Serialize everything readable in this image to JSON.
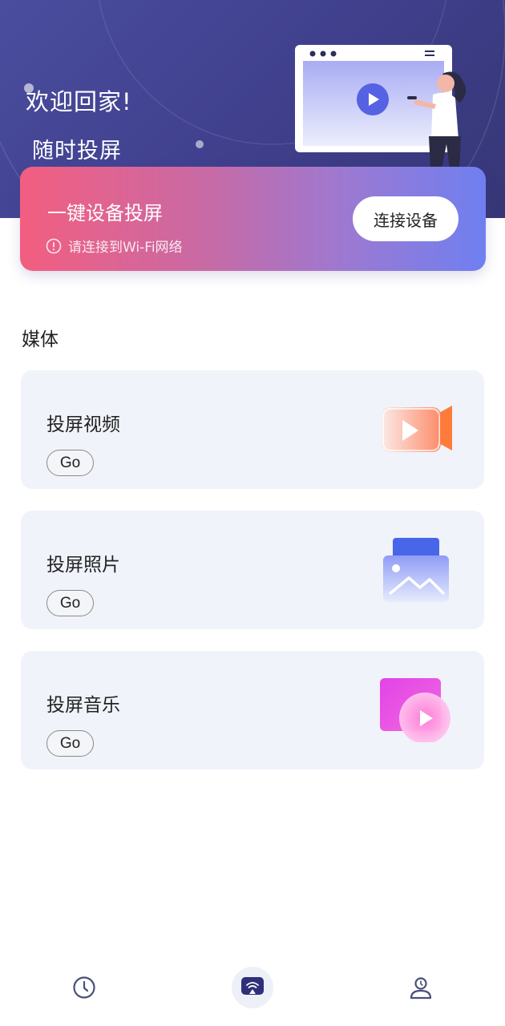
{
  "header": {
    "title": "欢迎回家!",
    "subtitle": "随时投屏"
  },
  "connect": {
    "title": "一键设备投屏",
    "warning": "请连接到Wi-Fi网络",
    "button_label": "连接设备"
  },
  "media": {
    "section_title": "媒体",
    "items": [
      {
        "label": "投屏视频",
        "go_label": "Go",
        "icon": "video-camera-icon"
      },
      {
        "label": "投屏照片",
        "go_label": "Go",
        "icon": "photo-icon"
      },
      {
        "label": "投屏音乐",
        "go_label": "Go",
        "icon": "music-play-icon"
      }
    ]
  },
  "nav": {
    "items": [
      {
        "icon": "clock-icon",
        "active": false
      },
      {
        "icon": "cast-icon",
        "active": true
      },
      {
        "icon": "profile-icon",
        "active": false
      }
    ]
  },
  "colors": {
    "header_bg": "#3f3f8c",
    "card_gradient_start": "#f35e80",
    "card_gradient_end": "#6f7ff0",
    "media_card_bg": "#f0f3fa",
    "nav_icon": "#4a4f7a"
  }
}
